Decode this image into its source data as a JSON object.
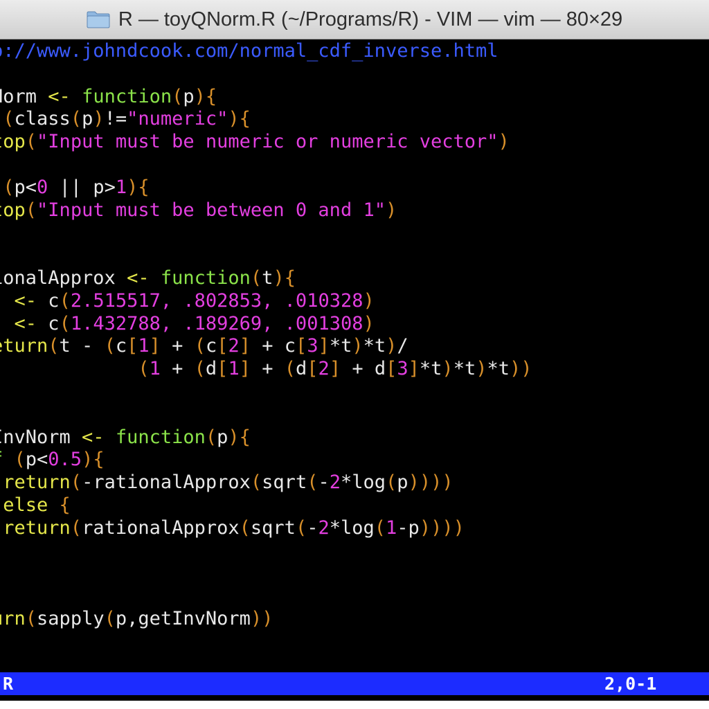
{
  "window": {
    "title": "R — toyQNorm.R (~/Programs/R) - VIM — vim — 80×29"
  },
  "editor": {
    "lines": [
      [
        {
          "t": "p://www.johndcook.com/normal_cdf_inverse.html",
          "c": "comment"
        }
      ],
      [],
      [
        {
          "t": "Norm ",
          "c": "ident"
        },
        {
          "t": "<- ",
          "c": "op"
        },
        {
          "t": "function",
          "c": "keyword"
        },
        {
          "t": "(",
          "c": "paren"
        },
        {
          "t": "p",
          "c": "ident"
        },
        {
          "t": "){",
          "c": "paren"
        }
      ],
      [
        {
          "t": " (",
          "c": "paren"
        },
        {
          "t": "class",
          "c": "ident"
        },
        {
          "t": "(",
          "c": "paren"
        },
        {
          "t": "p",
          "c": "ident"
        },
        {
          "t": ")",
          "c": "paren"
        },
        {
          "t": "!=",
          "c": "ident"
        },
        {
          "t": "\"numeric\"",
          "c": "string"
        },
        {
          "t": "){",
          "c": "paren"
        }
      ],
      [
        {
          "t": "top",
          "c": "func"
        },
        {
          "t": "(",
          "c": "paren"
        },
        {
          "t": "\"Input must be numeric or numeric vector\"",
          "c": "string"
        },
        {
          "t": ")",
          "c": "paren"
        }
      ],
      [],
      [
        {
          "t": " (",
          "c": "paren"
        },
        {
          "t": "p<",
          "c": "ident"
        },
        {
          "t": "0",
          "c": "number"
        },
        {
          "t": " || p>",
          "c": "ident"
        },
        {
          "t": "1",
          "c": "number"
        },
        {
          "t": "){",
          "c": "paren"
        }
      ],
      [
        {
          "t": "top",
          "c": "func"
        },
        {
          "t": "(",
          "c": "paren"
        },
        {
          "t": "\"Input must be between 0 and 1\"",
          "c": "string"
        },
        {
          "t": ")",
          "c": "paren"
        }
      ],
      [],
      [],
      [
        {
          "t": "ionalApprox ",
          "c": "ident"
        },
        {
          "t": "<- ",
          "c": "op"
        },
        {
          "t": "function",
          "c": "keyword"
        },
        {
          "t": "(",
          "c": "paren"
        },
        {
          "t": "t",
          "c": "ident"
        },
        {
          "t": "){",
          "c": "paren"
        }
      ],
      [
        {
          "t": "  ",
          "c": "ident"
        },
        {
          "t": "<- ",
          "c": "op"
        },
        {
          "t": "c",
          "c": "ident"
        },
        {
          "t": "(",
          "c": "paren"
        },
        {
          "t": "2.515517, .802853, .010328",
          "c": "number"
        },
        {
          "t": ")",
          "c": "paren"
        }
      ],
      [
        {
          "t": "  ",
          "c": "ident"
        },
        {
          "t": "<- ",
          "c": "op"
        },
        {
          "t": "c",
          "c": "ident"
        },
        {
          "t": "(",
          "c": "paren"
        },
        {
          "t": "1.432788, .189269, .001308",
          "c": "number"
        },
        {
          "t": ")",
          "c": "paren"
        }
      ],
      [
        {
          "t": "eturn",
          "c": "func"
        },
        {
          "t": "(",
          "c": "paren"
        },
        {
          "t": "t - ",
          "c": "ident"
        },
        {
          "t": "(",
          "c": "paren"
        },
        {
          "t": "c",
          "c": "ident"
        },
        {
          "t": "[",
          "c": "paren"
        },
        {
          "t": "1",
          "c": "number"
        },
        {
          "t": "]",
          "c": "paren"
        },
        {
          "t": " + ",
          "c": "ident"
        },
        {
          "t": "(",
          "c": "paren"
        },
        {
          "t": "c",
          "c": "ident"
        },
        {
          "t": "[",
          "c": "paren"
        },
        {
          "t": "2",
          "c": "number"
        },
        {
          "t": "]",
          "c": "paren"
        },
        {
          "t": " + c",
          "c": "ident"
        },
        {
          "t": "[",
          "c": "paren"
        },
        {
          "t": "3",
          "c": "number"
        },
        {
          "t": "]",
          "c": "paren"
        },
        {
          "t": "*t",
          "c": "ident"
        },
        {
          "t": ")",
          "c": "paren"
        },
        {
          "t": "*t",
          "c": "ident"
        },
        {
          "t": ")",
          "c": "paren"
        },
        {
          "t": "/",
          "c": "ident"
        }
      ],
      [
        {
          "t": "             ",
          "c": "ident"
        },
        {
          "t": "(",
          "c": "paren"
        },
        {
          "t": "1",
          "c": "number"
        },
        {
          "t": " + ",
          "c": "ident"
        },
        {
          "t": "(",
          "c": "paren"
        },
        {
          "t": "d",
          "c": "ident"
        },
        {
          "t": "[",
          "c": "paren"
        },
        {
          "t": "1",
          "c": "number"
        },
        {
          "t": "]",
          "c": "paren"
        },
        {
          "t": " + ",
          "c": "ident"
        },
        {
          "t": "(",
          "c": "paren"
        },
        {
          "t": "d",
          "c": "ident"
        },
        {
          "t": "[",
          "c": "paren"
        },
        {
          "t": "2",
          "c": "number"
        },
        {
          "t": "]",
          "c": "paren"
        },
        {
          "t": " + d",
          "c": "ident"
        },
        {
          "t": "[",
          "c": "paren"
        },
        {
          "t": "3",
          "c": "number"
        },
        {
          "t": "]",
          "c": "paren"
        },
        {
          "t": "*t",
          "c": "ident"
        },
        {
          "t": ")",
          "c": "paren"
        },
        {
          "t": "*t",
          "c": "ident"
        },
        {
          "t": ")",
          "c": "paren"
        },
        {
          "t": "*t",
          "c": "ident"
        },
        {
          "t": "))",
          "c": "paren"
        }
      ],
      [],
      [],
      [
        {
          "t": "InvNorm ",
          "c": "ident"
        },
        {
          "t": "<- ",
          "c": "op"
        },
        {
          "t": "function",
          "c": "keyword"
        },
        {
          "t": "(",
          "c": "paren"
        },
        {
          "t": "p",
          "c": "ident"
        },
        {
          "t": "){",
          "c": "paren"
        }
      ],
      [
        {
          "t": "f",
          "c": "keyword"
        },
        {
          "t": " (",
          "c": "paren"
        },
        {
          "t": "p<",
          "c": "ident"
        },
        {
          "t": "0.5",
          "c": "number"
        },
        {
          "t": "){",
          "c": "paren"
        }
      ],
      [
        {
          "t": " return",
          "c": "func"
        },
        {
          "t": "(",
          "c": "paren"
        },
        {
          "t": "-rationalApprox",
          "c": "ident"
        },
        {
          "t": "(",
          "c": "paren"
        },
        {
          "t": "sqrt",
          "c": "ident"
        },
        {
          "t": "(",
          "c": "paren"
        },
        {
          "t": "-",
          "c": "ident"
        },
        {
          "t": "2",
          "c": "number"
        },
        {
          "t": "*log",
          "c": "ident"
        },
        {
          "t": "(",
          "c": "paren"
        },
        {
          "t": "p",
          "c": "ident"
        },
        {
          "t": "))))",
          "c": "paren"
        }
      ],
      [
        {
          "t": " else ",
          "c": "func"
        },
        {
          "t": "{",
          "c": "paren"
        }
      ],
      [
        {
          "t": " return",
          "c": "func"
        },
        {
          "t": "(",
          "c": "paren"
        },
        {
          "t": "rationalApprox",
          "c": "ident"
        },
        {
          "t": "(",
          "c": "paren"
        },
        {
          "t": "sqrt",
          "c": "ident"
        },
        {
          "t": "(",
          "c": "paren"
        },
        {
          "t": "-",
          "c": "ident"
        },
        {
          "t": "2",
          "c": "number"
        },
        {
          "t": "*log",
          "c": "ident"
        },
        {
          "t": "(",
          "c": "paren"
        },
        {
          "t": "1",
          "c": "number"
        },
        {
          "t": "-p",
          "c": "ident"
        },
        {
          "t": "))))",
          "c": "paren"
        }
      ],
      [],
      [],
      [],
      [
        {
          "t": "urn",
          "c": "func"
        },
        {
          "t": "(",
          "c": "paren"
        },
        {
          "t": "sapply",
          "c": "ident"
        },
        {
          "t": "(",
          "c": "paren"
        },
        {
          "t": "p,getInvNorm",
          "c": "ident"
        },
        {
          "t": "))",
          "c": "paren"
        }
      ]
    ]
  },
  "status": {
    "filetype": "R",
    "position": "2,0-1"
  },
  "colors": {
    "background": "#000000",
    "status_bar": "#1c2cff",
    "comment": "#3b5bff",
    "string": "#e33fe0",
    "keyword": "#8be34a",
    "function": "#e5e74a",
    "paren": "#d9902a"
  },
  "icons": {
    "title": "folder-icon"
  }
}
